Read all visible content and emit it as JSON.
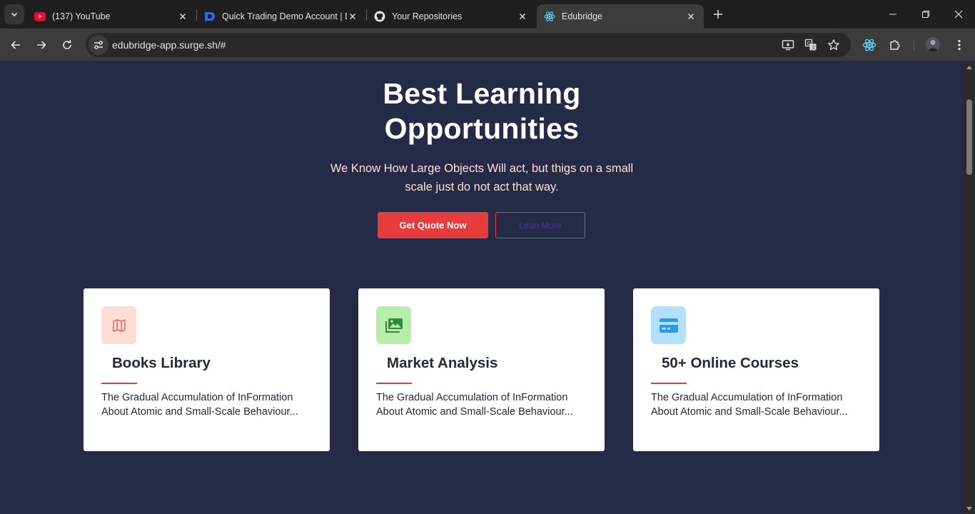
{
  "browser": {
    "tabs": [
      {
        "title": "(137) YouTube",
        "favicon": "youtube-icon",
        "active": false
      },
      {
        "title": "Quick Trading Demo Account | D",
        "favicon": "deriv-icon",
        "active": false
      },
      {
        "title": "Your Repositories",
        "favicon": "github-icon",
        "active": false
      },
      {
        "title": "Edubridge",
        "favicon": "react-icon",
        "active": true
      }
    ],
    "url": "edubridge-app.surge.sh/#"
  },
  "hero": {
    "title_line1": "Best Learning",
    "title_line2": "Opportunities",
    "subtitle": "We Know How Large Objects Will act, but thigs on a small scale just do not act that way.",
    "primary_button": "Get Quote Now",
    "secondary_button": "Lean More"
  },
  "cards": [
    {
      "icon": "map-icon",
      "icon_bg": "#fdddd6",
      "icon_color": "#e86a5a",
      "title": "Books Library",
      "text": "The Gradual Accumulation of InFormation About Atomic and Small-Scale Behaviour..."
    },
    {
      "icon": "images-icon",
      "icon_bg": "#b7edaa",
      "icon_color": "#2e8b3a",
      "title": "Market Analysis",
      "text": "The Gradual Accumulation of InFormation About Atomic and Small-Scale Behaviour..."
    },
    {
      "icon": "credit-card-icon",
      "icon_bg": "#b3e1fb",
      "icon_color": "#2f9be6",
      "title": "50+ Online Courses",
      "text": "The Gradual Accumulation of InFormation About Atomic and Small-Scale Behaviour..."
    }
  ],
  "colors": {
    "page_bg": "#252a47",
    "accent": "#e63c3c",
    "heading": "#232a3f"
  }
}
